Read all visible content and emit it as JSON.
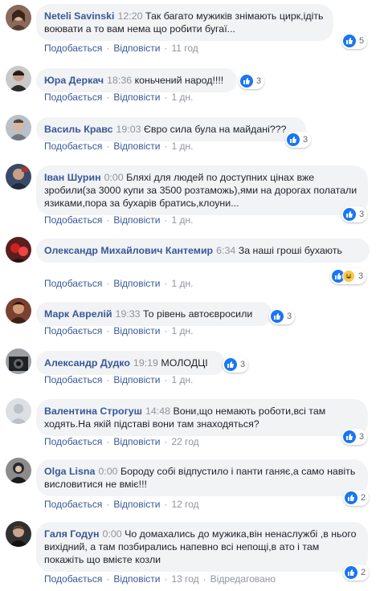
{
  "actions": {
    "like": "Подобається",
    "reply": "Відповісти",
    "edited": "Відредаговано"
  },
  "comments": [
    {
      "author": "Neteli Savinski",
      "time": "12:20",
      "text": "Так багато мужиків знімають цирк,ідіть воювати а то вам нема що робити бугаї...",
      "age": "11 год",
      "likes": "5"
    },
    {
      "author": "Юра Деркач",
      "time": "18:36",
      "text": "коньчений народ!!!!",
      "age": "1 дн.",
      "likes": "3"
    },
    {
      "author": "Василь Кравс",
      "time": "19:03",
      "text": "Євро сила була на майдані???",
      "age": "1 дн.",
      "likes": "3"
    },
    {
      "author": "Іван Шурин",
      "time": "0:00",
      "text": "Бляхі для людей по доступних цінах вже зробили(за 3000 купи за 3500 розтаможь),ями на дорогах полатали язиками,пора за бухарів братись,клоуни...",
      "age": "1 дн.",
      "likes": "3"
    },
    {
      "author": "Олександр Михайлович Кантемир",
      "time": "6:34",
      "text": "За наші гроші бухають",
      "age": "1 дн.",
      "likes": "3"
    },
    {
      "author": "Марк Аврелій",
      "time": "19:33",
      "text": "То рівень автоєвросили",
      "age": "1 дн.",
      "likes": "3"
    },
    {
      "author": "Александр Дудко",
      "time": "19:19",
      "text": "МОЛОДЦІ",
      "age": "1 дн.",
      "likes": "3"
    },
    {
      "author": "Валентина Строгуш",
      "time": "14:48",
      "text": "Вони,що немають роботи,всі там ходять.На якій підставі вони там знаходяться?",
      "age": "22 год",
      "likes": "3"
    },
    {
      "author": "Olga Lisna",
      "time": "0:00",
      "text": "Бороду собі відпустило і панти ганяє,а само навіть висловитися не вміє!!!",
      "age": "12 год",
      "likes": "2"
    },
    {
      "author": "Галя Годун",
      "time": "0:00",
      "text": "Чо домахались до мужика,він ненаслужбі ,в нього вихідний, а там позбирались напевно всі непощі,в ато і там покажіть що вмієте козли",
      "age": "13 год",
      "likes": "2"
    }
  ]
}
